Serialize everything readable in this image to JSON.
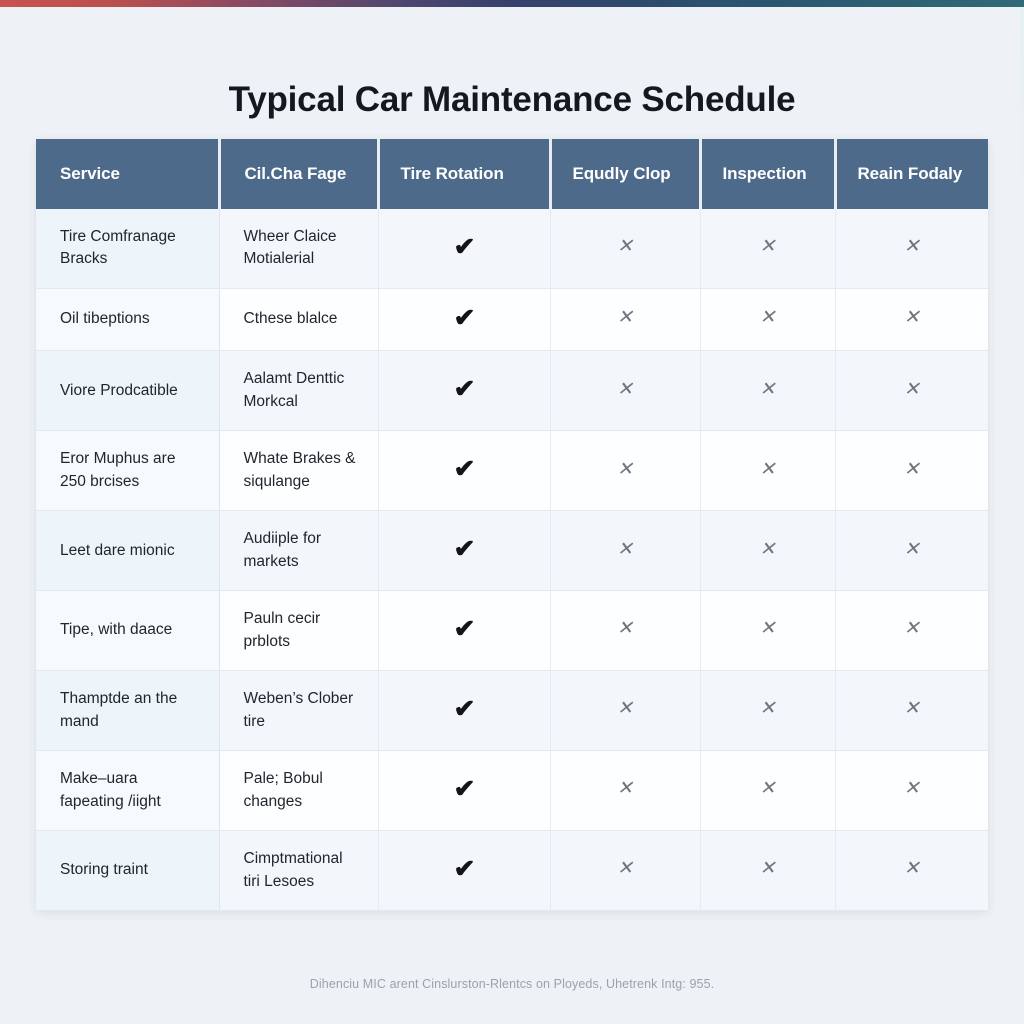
{
  "page": {
    "title": "Typical Car Maintenance Schedule",
    "footnote": "Dihenciu MIC arent Cinslurston-Rlentcs on Ployeds, Uhetrenk Intg: 955.",
    "accent_top_left": "#c9524f",
    "accent_top_right": "#316a76",
    "background": "#eef1f5",
    "header_background": "#4d6a8a",
    "header_text_color": "#ffffff",
    "row_stripe_color": "#f3f7fb",
    "row_alt_color": "#fdfeff",
    "service_column_tint": "#edf4fa",
    "check_color": "#121418",
    "cross_color": "#6d757f"
  },
  "table": {
    "headers": [
      "Service",
      "Cil.Cha Fage",
      "Tire Rotation",
      "Equdly Clop",
      "Inspection",
      "Reain Fodaly"
    ],
    "mark_glyphs": {
      "yes": "✔",
      "no": "✕"
    },
    "rows": [
      {
        "service": "Tire Comfranage Bracks",
        "detail": "Wheer Claice Motialerial",
        "tire_rotation": "yes",
        "equdly_clop": "no",
        "inspection": "no",
        "reain_fodaly": "no"
      },
      {
        "service": "Oil tibeptions",
        "detail": "Cthese blalce",
        "tire_rotation": "yes",
        "equdly_clop": "no",
        "inspection": "no",
        "reain_fodaly": "no"
      },
      {
        "service": "Viore Prodcatible",
        "detail": "Aalamt Denttic Morkcal",
        "tire_rotation": "yes",
        "equdly_clop": "no",
        "inspection": "no",
        "reain_fodaly": "no"
      },
      {
        "service": "Eror Muphus are 250 brcises",
        "detail": "Whate Brakes & siqulange",
        "tire_rotation": "yes",
        "equdly_clop": "no",
        "inspection": "no",
        "reain_fodaly": "no"
      },
      {
        "service": "Leet dare mionic",
        "detail": "Audiiple for markets",
        "tire_rotation": "yes",
        "equdly_clop": "no",
        "inspection": "no",
        "reain_fodaly": "no"
      },
      {
        "service": "Tipe, with daace",
        "detail": "Pauln cecir prblots",
        "tire_rotation": "yes",
        "equdly_clop": "no",
        "inspection": "no",
        "reain_fodaly": "no"
      },
      {
        "service": "Thamptde an the mand",
        "detail": "Weben’s Clober tire",
        "tire_rotation": "yes",
        "equdly_clop": "no",
        "inspection": "no",
        "reain_fodaly": "no"
      },
      {
        "service": "Make–uara fapeating /iight",
        "detail": "Pale; Bobul changes",
        "tire_rotation": "yes",
        "equdly_clop": "no",
        "inspection": "no",
        "reain_fodaly": "no"
      },
      {
        "service": "Storing traint",
        "detail": "Cimptmational tiri Lesoes",
        "tire_rotation": "yes",
        "equdly_clop": "no",
        "inspection": "no",
        "reain_fodaly": "no"
      }
    ]
  }
}
